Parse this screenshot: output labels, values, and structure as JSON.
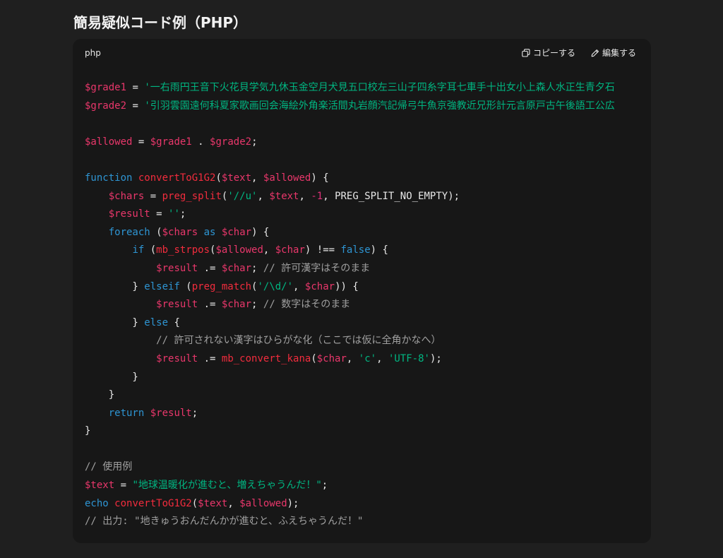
{
  "heading": "簡易疑似コード例（PHP）",
  "code_block": {
    "language": "php",
    "copy_label": "コピーする",
    "edit_label": "編集する",
    "colors": {
      "variable": "#e9376b",
      "string": "#00b581",
      "keyword": "#2e95d3",
      "function": "#f22c3d",
      "comment": "#a0a0a0",
      "number": "#df3079",
      "plain": "#e8e8e8"
    },
    "code": {
      "l1": {
        "a": "$grade1",
        "b": " = ",
        "c": "'一右雨円王音下火花貝学気九休玉金空月犬見五口校左三山子四糸字耳七車手十出女小上森人水正生青夕石"
      },
      "l2": {
        "a": "$grade2",
        "b": " = ",
        "c": "'引羽雲園遠何科夏家歌画回会海絵外角楽活間丸岩顔汽記帰弓牛魚京強教近兄形計元言原戸古午後語工公広"
      },
      "l4": {
        "a": "$allowed",
        "b": " = ",
        "c": "$grade1",
        "d": " . ",
        "e": "$grade2",
        "f": ";"
      },
      "l6": {
        "a": "function",
        "b": " ",
        "c": "convertToG1G2",
        "d": "(",
        "e": "$text",
        "f": ", ",
        "g": "$allowed",
        "h": ") {"
      },
      "l7": {
        "a": "    ",
        "b": "$chars",
        "c": " = ",
        "d": "preg_split",
        "e": "(",
        "f": "'//u'",
        "g": ", ",
        "h": "$text",
        "i": ", ",
        "j": "-1",
        "k": ", PREG_SPLIT_NO_EMPTY);"
      },
      "l8": {
        "a": "    ",
        "b": "$result",
        "c": " = ",
        "d": "''",
        "e": ";"
      },
      "l9": {
        "a": "    ",
        "b": "foreach",
        "c": " (",
        "d": "$chars",
        "e": " ",
        "f": "as",
        "g": " ",
        "h": "$char",
        "i": ") {"
      },
      "l10": {
        "a": "        ",
        "b": "if",
        "c": " (",
        "d": "mb_strpos",
        "e": "(",
        "f": "$allowed",
        "g": ", ",
        "h": "$char",
        "i": ") !== ",
        "j": "false",
        "k": ") {"
      },
      "l11": {
        "a": "            ",
        "b": "$result",
        "c": " .= ",
        "d": "$char",
        "e": "; ",
        "f": "// 許可漢字はそのまま"
      },
      "l12": {
        "a": "        } ",
        "b": "elseif",
        "c": " (",
        "d": "preg_match",
        "e": "(",
        "f": "'/\\d/'",
        "g": ", ",
        "h": "$char",
        "i": ")) {"
      },
      "l13": {
        "a": "            ",
        "b": "$result",
        "c": " .= ",
        "d": "$char",
        "e": "; ",
        "f": "// 数字はそのまま"
      },
      "l14": {
        "a": "        } ",
        "b": "else",
        "c": " {"
      },
      "l15": {
        "a": "            ",
        "b": "// 許可されない漢字はひらがな化（ここでは仮に全角かなへ）"
      },
      "l16": {
        "a": "            ",
        "b": "$result",
        "c": " .= ",
        "d": "mb_convert_kana",
        "e": "(",
        "f": "$char",
        "g": ", ",
        "h": "'c'",
        "i": ", ",
        "j": "'UTF-8'",
        "k": ");"
      },
      "l17": {
        "a": "        }"
      },
      "l18": {
        "a": "    }"
      },
      "l19": {
        "a": "    ",
        "b": "return",
        "c": " ",
        "d": "$result",
        "e": ";"
      },
      "l20": {
        "a": "}"
      },
      "l22": {
        "a": "// 使用例"
      },
      "l23": {
        "a": "$text",
        "b": " = ",
        "c": "\"地球温暖化が進むと、増えちゃうんだ！\"",
        "d": ";"
      },
      "l24": {
        "a": "echo",
        "b": " ",
        "c": "convertToG1G2",
        "d": "(",
        "e": "$text",
        "f": ", ",
        "g": "$allowed",
        "h": ");"
      },
      "l25": {
        "a": "// 出力: \"地きゅうおんだんかが進むと、ふえちゃうんだ！\""
      }
    }
  }
}
